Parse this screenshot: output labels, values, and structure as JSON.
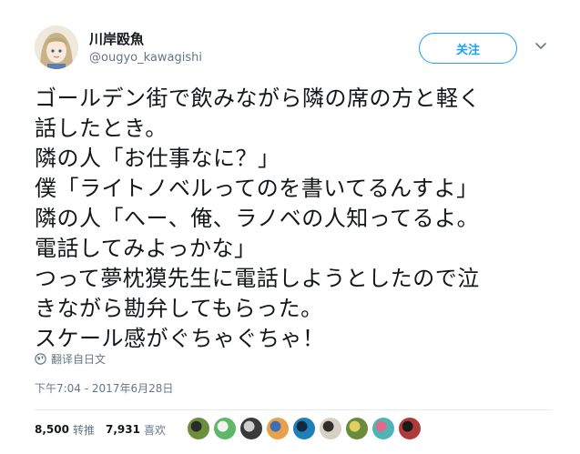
{
  "account": {
    "display_name": "川岸殴魚",
    "handle": "@ougyo_kawagishi",
    "follow_label": "关注"
  },
  "tweet": {
    "lines": [
      "ゴールデン街で飲みながら隣の席の方と軽く",
      "話したとき。",
      "隣の人「お仕事なに？」",
      "僕「ライトノベルってのを書いてるんすよ」",
      "隣の人「へー、俺、ラノベの人知ってるよ。",
      "電話してみよっかな」",
      "つって夢枕獏先生に電話しようとしたので泣",
      "きながら勘弁してもらった。",
      "スケール感がぐちゃぐちゃ！"
    ],
    "translate_label": "翻译自日文",
    "timestamp": "下午7:04 - 2017年6月28日"
  },
  "stats": {
    "retweets": "8,500",
    "retweets_label": "转推",
    "likes": "7,931",
    "likes_label": "喜欢"
  },
  "likers": [
    {
      "color": "#6b8f3a",
      "accent": "#2b2b2b"
    },
    {
      "color": "#5fb86a",
      "accent": "#f2f2f2"
    },
    {
      "color": "#3a3a3a",
      "accent": "#cfcfcf"
    },
    {
      "color": "#e8a04a",
      "accent": "#3c6fb5"
    },
    {
      "color": "#1f7fb8",
      "accent": "#0d2a40"
    },
    {
      "color": "#d9d0c4",
      "accent": "#2f2f2f"
    },
    {
      "color": "#6a8a3e",
      "accent": "#e0d060"
    },
    {
      "color": "#4fb4b8",
      "accent": "#e06a8a"
    },
    {
      "color": "#b03a3a",
      "accent": "#1a1a1a"
    }
  ]
}
